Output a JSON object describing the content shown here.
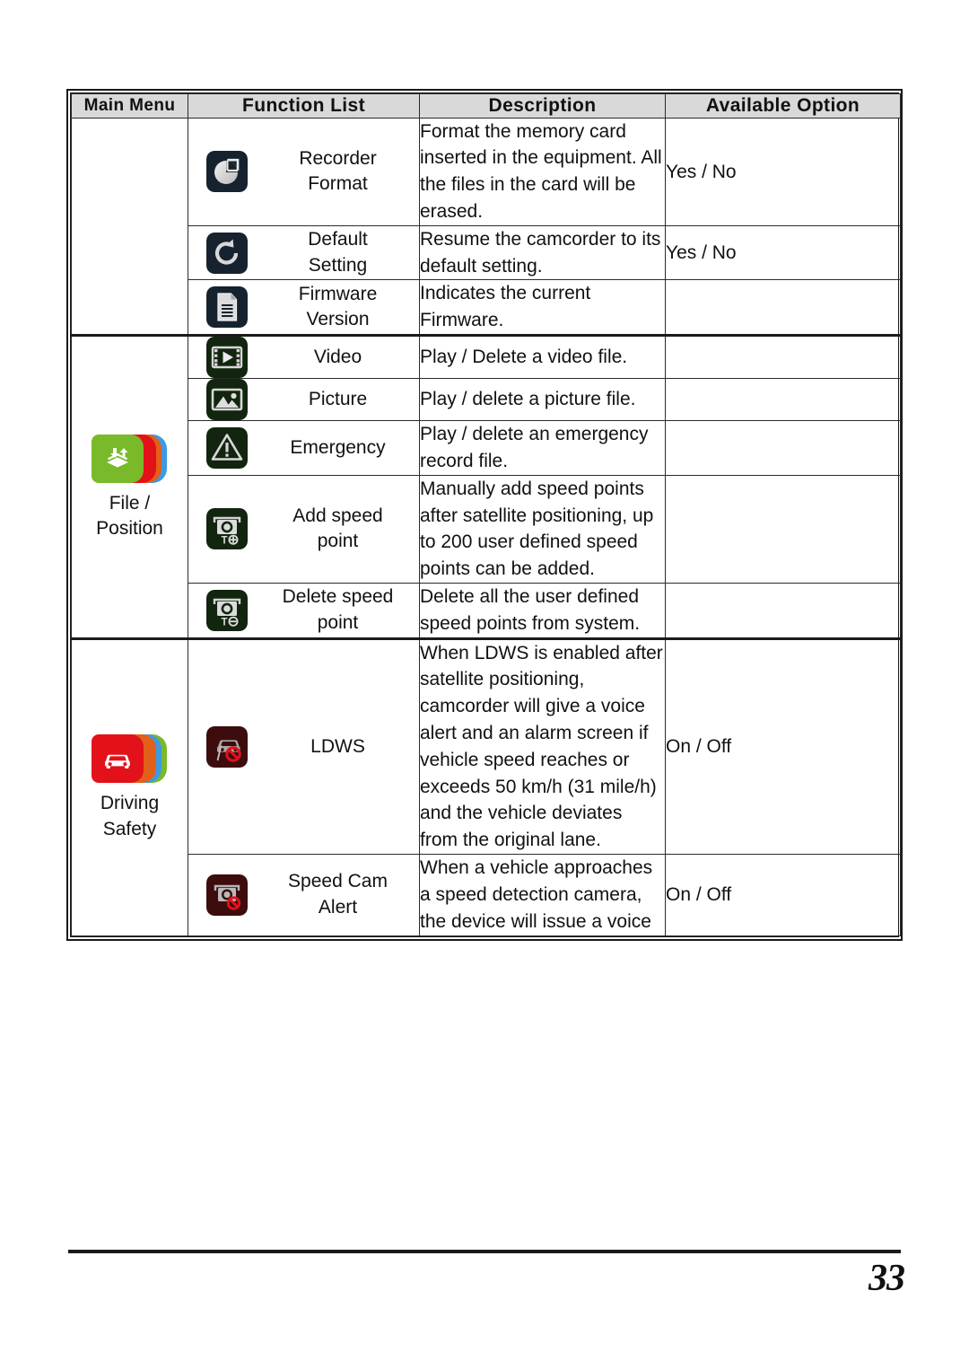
{
  "page": {
    "number": "33"
  },
  "table": {
    "headers": {
      "main_menu": "Main\nMenu",
      "function_list": "Function List",
      "description": "Description",
      "available_option": "Available Option"
    },
    "header_bg": "#d9d9d9",
    "sections": [
      {
        "menu_label": "",
        "menu_icon": "",
        "rows": [
          {
            "icon": "recorder-format-icon",
            "function": "Recorder\nFormat",
            "description": "Format the memory card inserted in the equipment. All the files in the card will be erased.",
            "option": "Yes / No"
          },
          {
            "icon": "default-setting-icon",
            "function": "Default\nSetting",
            "description": "Resume the camcorder to its default setting.",
            "option": ""
          },
          {
            "icon": "firmware-version-icon",
            "function": "Firmware\nVersion",
            "description": "Indicates the current Firmware.",
            "option": ""
          }
        ]
      },
      {
        "menu_label": "File /\nPosition",
        "menu_icon": "file-position-icon",
        "rows": [
          {
            "icon": "video-icon",
            "function": "Video",
            "description": "Play / Delete a video file.",
            "option": ""
          },
          {
            "icon": "picture-icon",
            "function": "Picture",
            "description": "Play / delete a picture file.",
            "option": ""
          },
          {
            "icon": "emergency-icon",
            "function": "Emergency",
            "description": "Play / delete an emergency record file.",
            "option": ""
          },
          {
            "icon": "add-speed-point-icon",
            "function": "Add speed\npoint",
            "description": "Manually add speed points after satellite positioning, up to 200 user defined speed points can be added.",
            "option": ""
          },
          {
            "icon": "delete-speed-point-icon",
            "function": "Delete speed\npoint",
            "description": "Delete all the user defined speed points from system.",
            "option": ""
          }
        ]
      },
      {
        "menu_label": "Driving\nSafety",
        "menu_icon": "driving-safety-icon",
        "rows": [
          {
            "icon": "ldws-icon",
            "function": "LDWS",
            "description": "When LDWS is enabled after satellite positioning, camcorder will give a voice alert and an alarm screen if vehicle speed reaches or exceeds 50 km/h (31 mile/h) and the vehicle deviates from the original lane.",
            "option": "On / Off"
          },
          {
            "icon": "speed-cam-alert-icon",
            "function": "Speed Cam\nAlert",
            "description": "When a vehicle approaches a speed detection camera, the device will issue a voice",
            "option": "On / Off"
          }
        ]
      }
    ]
  },
  "row_option_yesno_2": "Yes / No",
  "colors": {
    "icon_navy": "#16232f",
    "icon_green": "#12250f",
    "icon_maroon": "#3d0d0d",
    "menu_green": "#7ab929",
    "menu_red": "#e2111a",
    "menu_orange": "#e2601a",
    "menu_blue": "#3d9ae2",
    "card_red": "#e2111a",
    "card_orange": "#e2601a",
    "card_blue": "#3d9ae2",
    "card_green": "#7ab929",
    "icon_silver": "#d8d8d8",
    "alert_red": "#e2111a"
  }
}
